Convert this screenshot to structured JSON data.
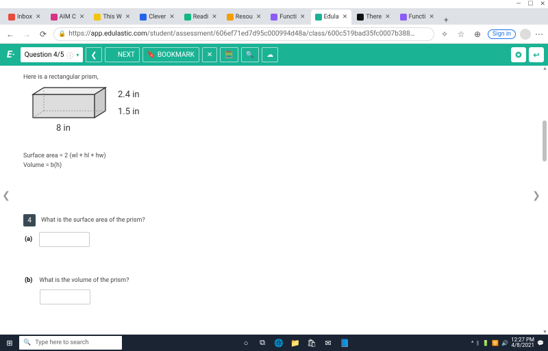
{
  "window": {
    "min": "—",
    "max": "☐",
    "close": "✕"
  },
  "tabs": [
    {
      "label": "Inbox",
      "fav": "#e74c3c"
    },
    {
      "label": "AIM C",
      "fav": "#d63384"
    },
    {
      "label": "This W",
      "fav": "#f1c40f"
    },
    {
      "label": "Clever",
      "fav": "#2563eb"
    },
    {
      "label": "Readi",
      "fav": "#10b981"
    },
    {
      "label": "Resou",
      "fav": "#f59e0b"
    },
    {
      "label": "Functi",
      "fav": "#8b5cf6"
    },
    {
      "label": "Edula",
      "fav": "#1ab394",
      "active": true
    },
    {
      "label": "There",
      "fav": "#111"
    },
    {
      "label": "Functi",
      "fav": "#8b5cf6"
    }
  ],
  "addr": {
    "back": "←",
    "fwd": "→",
    "reload": "⟳",
    "lock": "🔒",
    "host": "app.edulastic.com",
    "path": "/student/assessment/606ef71ed7d95c000994d48a/class/600c519bad35fc0007b388…",
    "signin": "Sign in",
    "menu": "⋯"
  },
  "app": {
    "logo": "E·",
    "question": "Question 4/5",
    "info": "ⓘ",
    "chev": "▾",
    "prev": "❮",
    "next": "NEXT",
    "next_arrow": "❯",
    "bookmark": "BOOKMARK",
    "bm_icon": "🔖",
    "close": "✕",
    "calc": "🧮",
    "search": "🔍",
    "cloud": "☁",
    "access": "✪",
    "exit": "↩"
  },
  "problem": {
    "intro": "Here is a rectangular prism,",
    "height": "2.4 in",
    "depth": "1.5 in",
    "width": "8 in",
    "surface_formula": "Surface area = 2 (wl + hl + hw)",
    "volume_formula": "Volume = b(h)",
    "qnum": "4",
    "qtext": "What is the surface area of the prism?",
    "part_a": "(a)",
    "part_b": "(b)",
    "qtext_b": "What is the volume of the prism?"
  },
  "caret": {
    "left": "❮",
    "right": "❯"
  },
  "taskbar": {
    "win": "⊞",
    "search_icon": "🔍",
    "search": "Type here to search",
    "cortana": "○",
    "task": "⧉",
    "edge": "🌐",
    "files": "📁",
    "store": "🛍",
    "mail": "✉",
    "word": "📘",
    "tray_up": "^",
    "bt": "ᛒ",
    "batt": "🔋",
    "wifi": "🛜",
    "snd": "🔊",
    "time": "12:27 PM",
    "date": "4/8/2021",
    "notif": "💬"
  }
}
